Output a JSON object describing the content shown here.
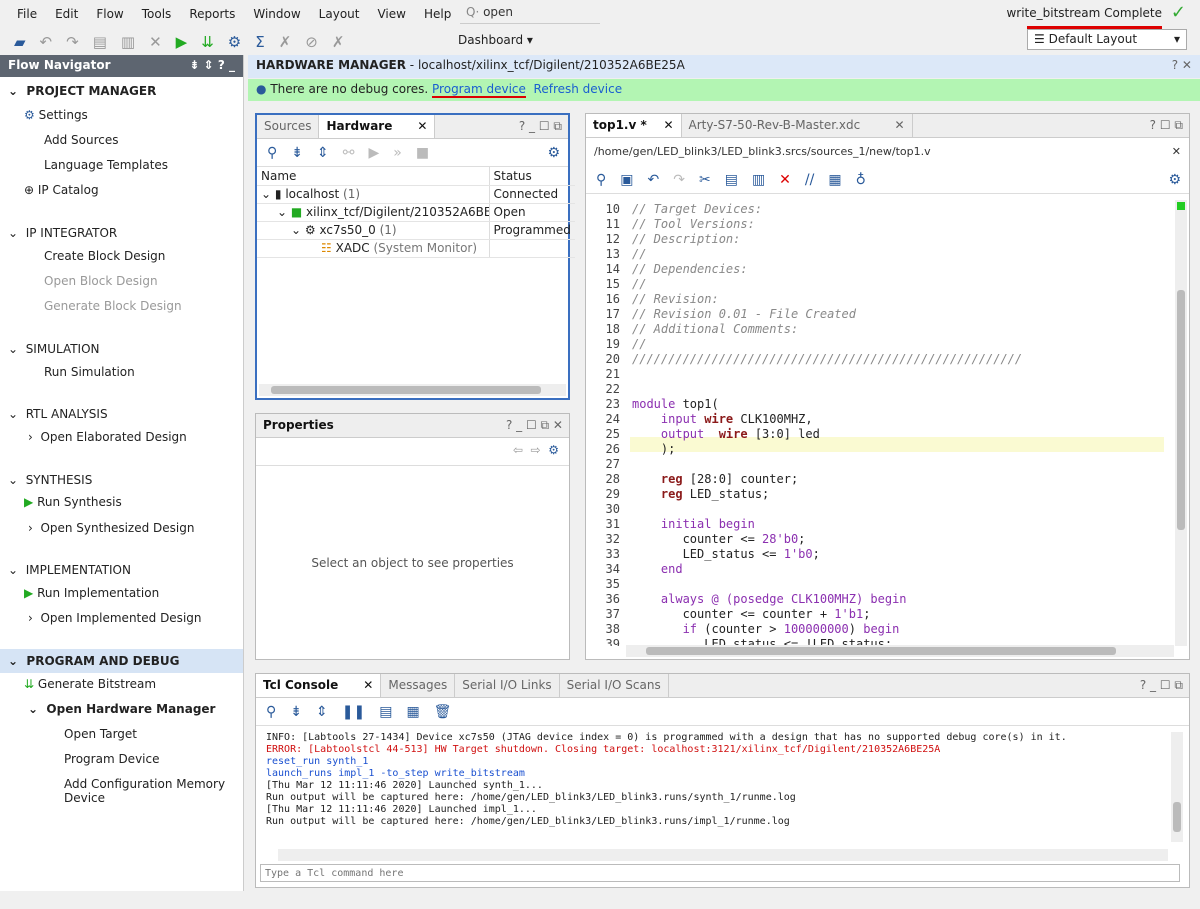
{
  "menu": [
    "File",
    "Edit",
    "Flow",
    "Tools",
    "Reports",
    "Window",
    "Layout",
    "View",
    "Help"
  ],
  "search": {
    "value": "open"
  },
  "status": {
    "text": "write_bitstream Complete"
  },
  "toolbar": {
    "dashboard": "Dashboard ▾",
    "layout": "Default Layout"
  },
  "nav": {
    "title": "Flow Navigator",
    "project_manager": "PROJECT MANAGER",
    "settings": "Settings",
    "add_sources": "Add Sources",
    "language_templates": "Language Templates",
    "ip_catalog": "IP Catalog",
    "ip_integrator": "IP INTEGRATOR",
    "create_bd": "Create Block Design",
    "open_bd": "Open Block Design",
    "generate_bd": "Generate Block Design",
    "simulation": "SIMULATION",
    "run_sim": "Run Simulation",
    "rtl": "RTL ANALYSIS",
    "open_elab": "Open Elaborated Design",
    "synthesis": "SYNTHESIS",
    "run_synth": "Run Synthesis",
    "open_synth": "Open Synthesized Design",
    "implementation": "IMPLEMENTATION",
    "run_impl": "Run Implementation",
    "open_impl": "Open Implemented Design",
    "pad": "PROGRAM AND DEBUG",
    "gen_bit": "Generate Bitstream",
    "open_hw": "Open Hardware Manager",
    "open_target": "Open Target",
    "program_device": "Program Device",
    "add_cfg": "Add Configuration Memory Device"
  },
  "hm": {
    "title": "HARDWARE MANAGER",
    "path": " - localhost/xilinx_tcf/Digilent/210352A6BE25A",
    "info": "There are no debug cores.",
    "program": "Program device",
    "refresh": "Refresh device"
  },
  "hardware": {
    "tabs": [
      "Sources",
      "Hardware"
    ],
    "col_name": "Name",
    "col_status": "Status",
    "rows": [
      {
        "name": "localhost",
        "count": "(1)",
        "status": "Connected"
      },
      {
        "name": "xilinx_tcf/Digilent/210352A6BE",
        "status": "Open"
      },
      {
        "name": "xc7s50_0",
        "count": "(1)",
        "status": "Programmed"
      },
      {
        "name": "XADC",
        "sub": "(System Monitor)",
        "status": ""
      }
    ]
  },
  "properties": {
    "title": "Properties",
    "empty": "Select an object to see properties"
  },
  "editor": {
    "tabs": [
      "top1.v *",
      "Arty-S7-50-Rev-B-Master.xdc"
    ],
    "path": "/home/gen/LED_blink3/LED_blink3.srcs/sources_1/new/top1.v",
    "lines": [
      {
        "n": "10",
        "s": [
          [
            "// Target Devices:",
            "cm"
          ]
        ]
      },
      {
        "n": "11",
        "s": [
          [
            "// Tool Versions:",
            "cm"
          ]
        ]
      },
      {
        "n": "12",
        "s": [
          [
            "// Description:",
            "cm"
          ]
        ]
      },
      {
        "n": "13",
        "s": [
          [
            "//",
            "cm"
          ]
        ]
      },
      {
        "n": "14",
        "s": [
          [
            "// Dependencies:",
            "cm"
          ]
        ]
      },
      {
        "n": "15",
        "s": [
          [
            "//",
            "cm"
          ]
        ]
      },
      {
        "n": "16",
        "s": [
          [
            "// Revision:",
            "cm"
          ]
        ]
      },
      {
        "n": "17",
        "s": [
          [
            "// Revision 0.01 - File Created",
            "cm"
          ]
        ]
      },
      {
        "n": "18",
        "s": [
          [
            "// Additional Comments:",
            "cm"
          ]
        ]
      },
      {
        "n": "19",
        "s": [
          [
            "//",
            "cm"
          ]
        ]
      },
      {
        "n": "20",
        "s": [
          [
            "//////////////////////////////////////////////////////",
            "cm"
          ]
        ]
      },
      {
        "n": "21",
        "s": []
      },
      {
        "n": "22",
        "s": []
      },
      {
        "n": "23",
        "s": [
          [
            "module",
            "kw"
          ],
          [
            " top1(",
            "tx"
          ]
        ]
      },
      {
        "n": "24",
        "s": [
          [
            "    input ",
            "io"
          ],
          [
            "wire",
            "ty"
          ],
          [
            " CLK100MHZ,",
            "tx"
          ]
        ]
      },
      {
        "n": "25",
        "s": [
          [
            "    output  ",
            "io"
          ],
          [
            "wire",
            "ty"
          ],
          [
            " [3:0] led",
            "tx"
          ]
        ]
      },
      {
        "n": "26",
        "s": [
          [
            "    );",
            "tx"
          ]
        ]
      },
      {
        "n": "27",
        "s": []
      },
      {
        "n": "28",
        "s": [
          [
            "    reg",
            "ty"
          ],
          [
            " [28:0] counter;",
            "tx"
          ]
        ]
      },
      {
        "n": "29",
        "s": [
          [
            "    reg",
            "ty"
          ],
          [
            " LED_status;",
            "tx"
          ]
        ]
      },
      {
        "n": "30",
        "s": []
      },
      {
        "n": "31",
        "s": [
          [
            "    initial begin",
            "kw"
          ]
        ]
      },
      {
        "n": "32",
        "s": [
          [
            "       counter <= ",
            "tx"
          ],
          [
            "28'b0",
            "num"
          ],
          [
            ";",
            "tx"
          ]
        ]
      },
      {
        "n": "33",
        "s": [
          [
            "       LED_status <= ",
            "tx"
          ],
          [
            "1'b0",
            "num"
          ],
          [
            ";",
            "tx"
          ]
        ]
      },
      {
        "n": "34",
        "s": [
          [
            "    end",
            "kw"
          ]
        ]
      },
      {
        "n": "35",
        "s": []
      },
      {
        "n": "36",
        "s": [
          [
            "    always @ (posedge CLK100MHZ) begin",
            "kw"
          ]
        ]
      },
      {
        "n": "37",
        "s": [
          [
            "       counter <= counter + ",
            "tx"
          ],
          [
            "1'b1",
            "num"
          ],
          [
            ";",
            "tx"
          ]
        ]
      },
      {
        "n": "38",
        "s": [
          [
            "       if",
            "kw"
          ],
          [
            " (counter > ",
            "tx"
          ],
          [
            "100000000",
            "num"
          ],
          [
            ") ",
            "tx"
          ],
          [
            "begin",
            "kw"
          ]
        ]
      },
      {
        "n": "39",
        "s": [
          [
            "          LED_status <= !LED_status;",
            "tx"
          ]
        ]
      }
    ]
  },
  "console": {
    "tabs": [
      "Tcl Console",
      "Messages",
      "Serial I/O Links",
      "Serial I/O Scans"
    ],
    "placeholder": "Type a Tcl command here",
    "lines": [
      {
        "t": "INFO: [Labtools 27-1434] Device xc7s50 (JTAG device index = 0) is programmed with a design that has no supported debug core(s) in it.",
        "k": "info"
      },
      {
        "t": "ERROR: [Labtoolstcl 44-513] HW Target shutdown. Closing target: localhost:3121/xilinx_tcf/Digilent/210352A6BE25A",
        "k": "err"
      },
      {
        "t": "reset_run synth_1",
        "k": "cmd"
      },
      {
        "t": "launch_runs impl_1 -to_step write_bitstream",
        "k": "cmd"
      },
      {
        "t": "[Thu Mar 12 11:11:46 2020] Launched synth_1...",
        "k": "info"
      },
      {
        "t": "Run output will be captured here: /home/gen/LED_blink3/LED_blink3.runs/synth_1/runme.log",
        "k": "info"
      },
      {
        "t": "[Thu Mar 12 11:11:46 2020] Launched impl_1...",
        "k": "info"
      },
      {
        "t": "Run output will be captured here: /home/gen/LED_blink3/LED_blink3.runs/impl_1/runme.log",
        "k": "info"
      }
    ]
  }
}
